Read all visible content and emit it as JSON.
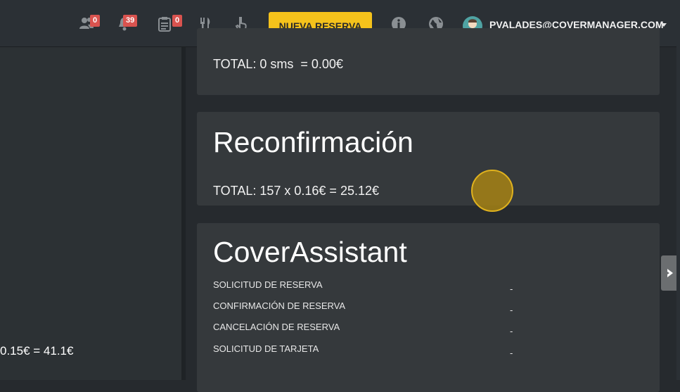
{
  "header": {
    "groups_badge": "0",
    "notifications_badge": "39",
    "tasks_badge": "0",
    "new_booking_label": "NUEVA RESERVA",
    "user_email": "PVALADES@COVERMANAGER.COM",
    "accent_color": "#f5c21b",
    "badge_color": "#d9534f"
  },
  "left_panel": {
    "partial_total": "0.15€ = 41.1€"
  },
  "cards": {
    "previous": {
      "total": "TOTAL: 0 sms  = 0.00€"
    },
    "reconfirmation": {
      "title": "Reconfirmación",
      "total": "TOTAL: 157 x 0.16€ = 25.12€"
    },
    "cover_assistant": {
      "title": "CoverAssistant",
      "rows": [
        {
          "label": "SOLICITUD DE RESERVA",
          "value": "-"
        },
        {
          "label": "CONFIRMACIÓN DE RESERVA",
          "value": "-"
        },
        {
          "label": "CANCELACIÓN DE RESERVA",
          "value": "-"
        },
        {
          "label": "SOLICITUD DE TARJETA",
          "value": "-"
        }
      ]
    }
  }
}
